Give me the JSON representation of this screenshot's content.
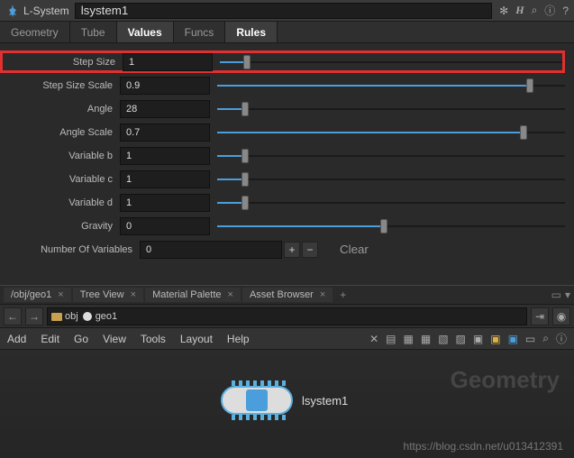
{
  "titlebar": {
    "label": "L-System",
    "name": "lsystem1"
  },
  "tabs": [
    "Geometry",
    "Tube",
    "Values",
    "Funcs",
    "Rules"
  ],
  "activeTab": 2,
  "params": {
    "stepSize": {
      "label": "Step Size",
      "value": "1",
      "fill": 8
    },
    "stepScale": {
      "label": "Step Size Scale",
      "value": "0.9",
      "fill": 90
    },
    "angle": {
      "label": "Angle",
      "value": "28",
      "fill": 8
    },
    "angleScale": {
      "label": "Angle Scale",
      "value": "0.7",
      "fill": 88
    },
    "varB": {
      "label": "Variable b",
      "value": "1",
      "fill": 8
    },
    "varC": {
      "label": "Variable c",
      "value": "1",
      "fill": 8
    },
    "varD": {
      "label": "Variable d",
      "value": "1",
      "fill": 8
    },
    "gravity": {
      "label": "Gravity",
      "value": "0",
      "fill": 48
    },
    "numVars": {
      "label": "Number Of Variables",
      "value": "0",
      "clear": "Clear"
    }
  },
  "miniTabs": [
    "/obj/geo1",
    "Tree View",
    "Material Palette",
    "Asset Browser"
  ],
  "path": {
    "seg1": "obj",
    "seg2": "geo1"
  },
  "menus": [
    "Add",
    "Edit",
    "Go",
    "View",
    "Tools",
    "Layout",
    "Help"
  ],
  "viewport": {
    "bgText": "Geometry",
    "nodeLabel": "lsystem1"
  },
  "watermark": "https://blog.csdn.net/u013412391"
}
